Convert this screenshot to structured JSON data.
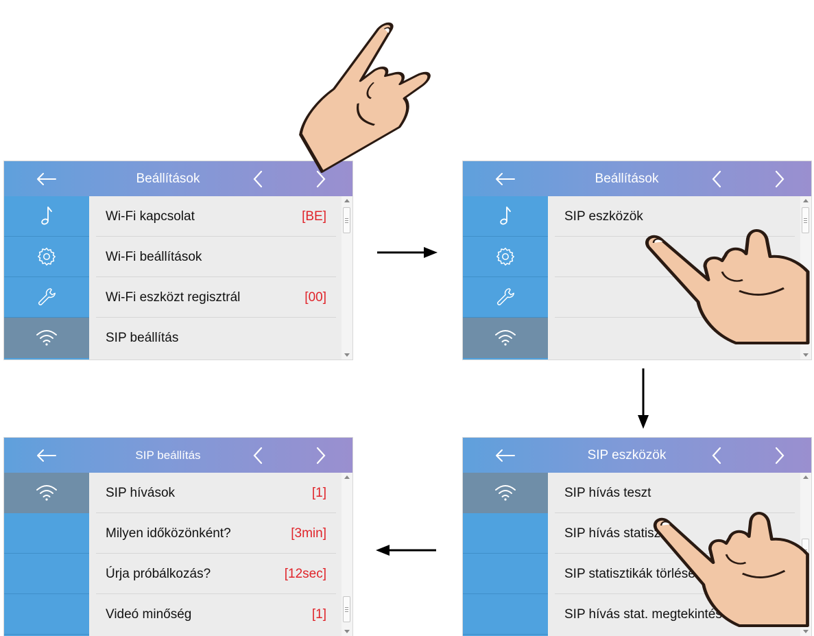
{
  "screens": [
    {
      "title": "Beállítások",
      "side": [
        "music",
        "gear",
        "wrench",
        "wifi"
      ],
      "selected_side": 3,
      "rows": [
        {
          "label": "Wi-Fi kapcsolat",
          "value": "[BE]"
        },
        {
          "label": "Wi-Fi beállítások",
          "value": ""
        },
        {
          "label": "Wi-Fi eszközt regisztrál",
          "value": "[00]"
        },
        {
          "label": "SIP beállítás",
          "value": ""
        }
      ]
    },
    {
      "title": "Beállítások",
      "side": [
        "music",
        "gear",
        "wrench",
        "wifi"
      ],
      "selected_side": 3,
      "rows": [
        {
          "label": "SIP eszközök",
          "value": ""
        },
        {
          "label": "",
          "value": ""
        },
        {
          "label": "",
          "value": ""
        },
        {
          "label": "",
          "value": ""
        }
      ]
    },
    {
      "title": "SIP eszközök",
      "side": [
        "wifi",
        "",
        "",
        ""
      ],
      "selected_side": 0,
      "rows": [
        {
          "label": "SIP hívás teszt",
          "value": ""
        },
        {
          "label": "SIP hívás statisztika",
          "value": ""
        },
        {
          "label": "SIP statisztikák törlése",
          "value": ""
        },
        {
          "label": "SIP hívás stat. megtekintése",
          "value": ""
        }
      ]
    },
    {
      "title": "SIP beállítás",
      "side": [
        "wifi",
        "",
        "",
        ""
      ],
      "selected_side": 0,
      "rows": [
        {
          "label": "SIP hívások",
          "value": "[1]"
        },
        {
          "label": "Milyen időközönként?",
          "value": "[3min]"
        },
        {
          "label": "Úrja próbálkozás?",
          "value": "[12sec]"
        },
        {
          "label": "Videó minőség",
          "value": "[1]"
        }
      ]
    }
  ],
  "icons": {
    "back": "arrow-left-icon",
    "prev": "chevron-left-icon",
    "next": "chevron-right-icon",
    "music": "music-note-icon",
    "gear": "gear-icon",
    "wrench": "wrench-icon",
    "wifi": "wifi-icon",
    "hand": "pointing-hand-icon"
  },
  "colors": {
    "header_start": "#5fa0dc",
    "header_end": "#9a8fcf",
    "sidebar": "#4fa2df",
    "sidebar_selected": "#6f8ea8",
    "value_red": "#e0242a"
  }
}
